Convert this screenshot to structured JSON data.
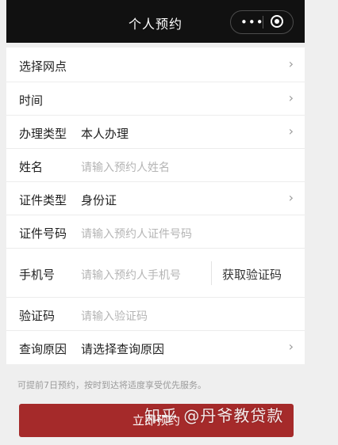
{
  "header": {
    "title": "个人预约",
    "more_icon_glyph": "•••"
  },
  "form": {
    "rows": [
      {
        "label": "选择网点",
        "value": "",
        "placeholder": "",
        "chevron": true
      },
      {
        "label": "时间",
        "value": "",
        "placeholder": "",
        "chevron": true
      },
      {
        "label": "办理类型",
        "value": "本人办理",
        "placeholder": "",
        "chevron": true
      },
      {
        "label": "姓名",
        "value": "",
        "placeholder": "请输入预约人姓名",
        "chevron": false
      },
      {
        "label": "证件类型",
        "value": "身份证",
        "placeholder": "",
        "chevron": true
      },
      {
        "label": "证件号码",
        "value": "",
        "placeholder": "请输入预约人证件号码",
        "chevron": false
      },
      {
        "label": "手机号",
        "value": "",
        "placeholder": "请输入预约人手机号",
        "chevron": false
      },
      {
        "label": "验证码",
        "value": "",
        "placeholder": "请输入验证码",
        "chevron": false
      },
      {
        "label": "查询原因",
        "value": "请选择查询原因",
        "placeholder": "",
        "chevron": true
      }
    ],
    "chevron_glyph": "›",
    "get_code_label": "获取验证码"
  },
  "hint": "可提前7日预约，按时到达将适度享受优先服务。",
  "submit_label": "立即预约",
  "watermark": "知乎 @丹爷教贷款",
  "colors": {
    "header_bg": "#111111",
    "submit_bg": "#a52a2a",
    "page_bg": "#efefef"
  }
}
